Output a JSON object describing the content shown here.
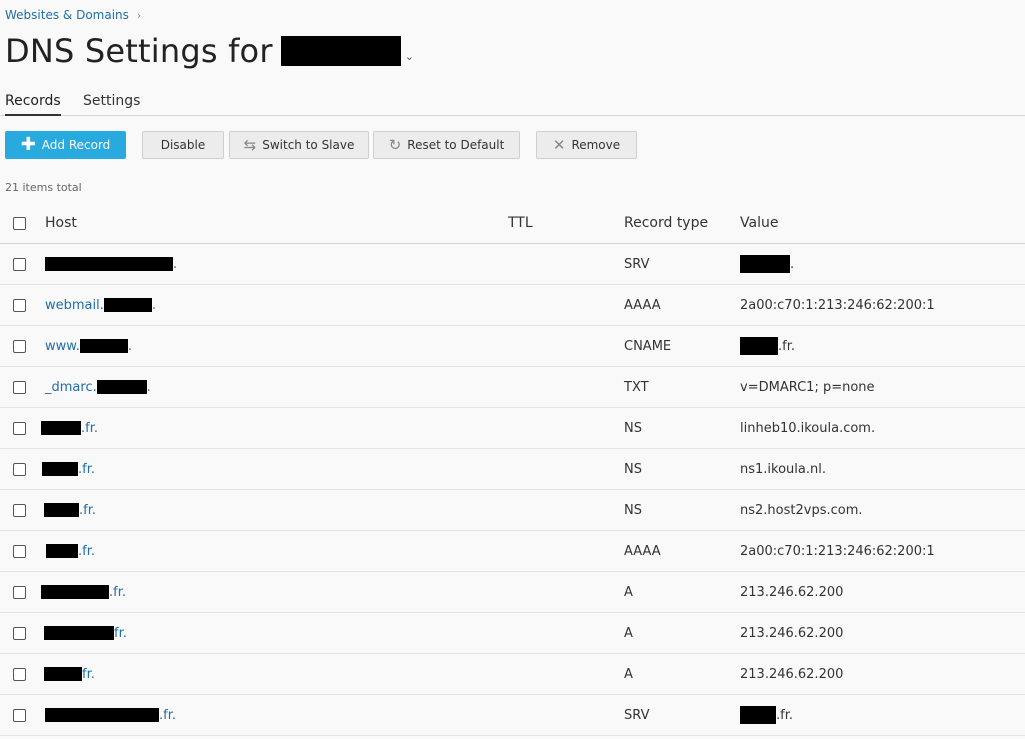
{
  "breadcrumb": {
    "label": "Websites & Domains",
    "chevron": "›"
  },
  "page": {
    "title": "DNS Settings for",
    "caret": "⌄"
  },
  "tabs": [
    {
      "label": "Records",
      "active": true
    },
    {
      "label": "Settings",
      "active": false
    }
  ],
  "toolbar": {
    "add_label": "Add Record",
    "disable_label": "Disable",
    "switch_label": "Switch to Slave",
    "reset_label": "Reset to Default",
    "remove_label": "Remove",
    "icons": {
      "add": "plus-icon",
      "switch": "switch-arrows-icon",
      "reset": "reset-arrow-icon",
      "remove": "x-icon"
    },
    "primary_color": "#28aadf"
  },
  "list": {
    "items_total": "21 items total"
  },
  "table": {
    "columns": {
      "host": "Host",
      "ttl": "TTL",
      "type": "Record type",
      "value": "Value"
    },
    "rows": [
      {
        "host_prefix": "",
        "host_suffix": ".",
        "type": "SRV",
        "value_text": ".",
        "value_redacted": true
      },
      {
        "host_prefix": "webmail.",
        "host_suffix": ".",
        "type": "AAAA",
        "value_text": "2a00:c70:1:213:246:62:200:1",
        "value_redacted": false
      },
      {
        "host_prefix": "www.",
        "host_suffix": ".",
        "type": "CNAME",
        "value_text": ".fr.",
        "value_redacted": true
      },
      {
        "host_prefix": "_dmarc.",
        "host_suffix": ".",
        "type": "TXT",
        "value_text": "v=DMARC1; p=none",
        "value_redacted": false
      },
      {
        "host_prefix": "",
        "host_suffix": ".fr.",
        "type": "NS",
        "value_text": "linheb10.ikoula.com.",
        "value_redacted": false
      },
      {
        "host_prefix": "",
        "host_suffix": ".fr.",
        "type": "NS",
        "value_text": "ns1.ikoula.nl.",
        "value_redacted": false
      },
      {
        "host_prefix": "",
        "host_suffix": ".fr.",
        "type": "NS",
        "value_text": "ns2.host2vps.com.",
        "value_redacted": false
      },
      {
        "host_prefix": "",
        "host_suffix": ".fr.",
        "type": "AAAA",
        "value_text": "2a00:c70:1:213:246:62:200:1",
        "value_redacted": false
      },
      {
        "host_prefix": "",
        "host_suffix": ".fr.",
        "type": "A",
        "value_text": "213.246.62.200",
        "value_redacted": false
      },
      {
        "host_prefix": "",
        "host_suffix": "fr.",
        "type": "A",
        "value_text": "213.246.62.200",
        "value_redacted": false
      },
      {
        "host_prefix": "",
        "host_suffix": "fr.",
        "type": "A",
        "value_text": "213.246.62.200",
        "value_redacted": false
      },
      {
        "host_prefix": "",
        "host_suffix": ".fr.",
        "type": "SRV",
        "value_text": ".fr.",
        "value_redacted": true
      }
    ]
  }
}
